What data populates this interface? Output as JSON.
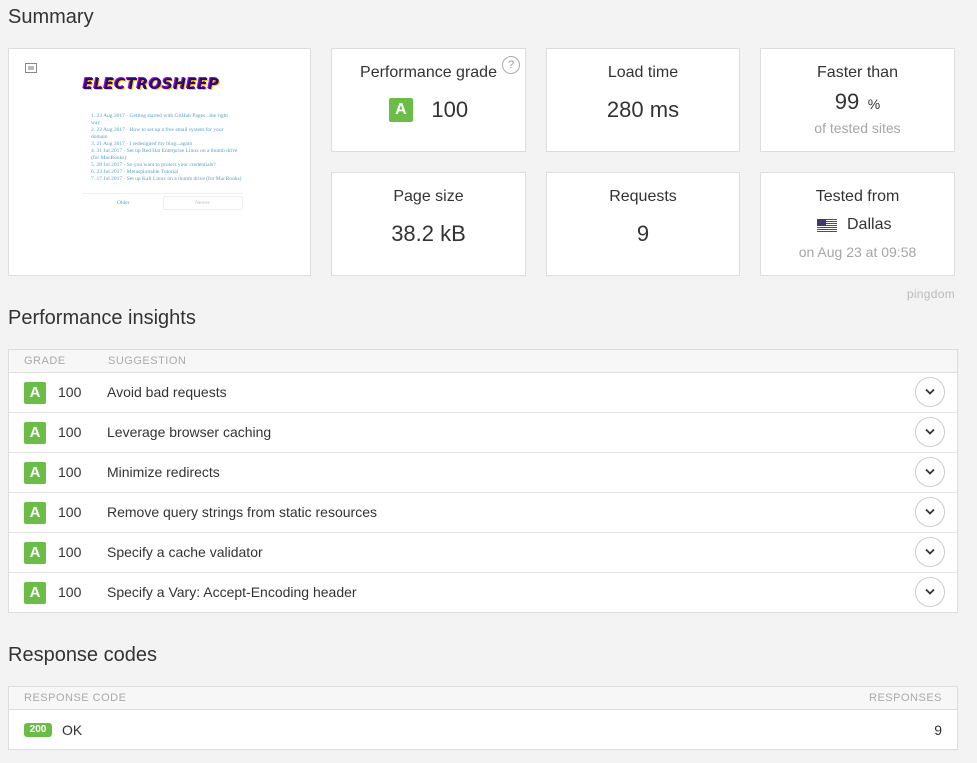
{
  "summary": {
    "title": "Summary",
    "thumbnail": {
      "logo": "ELECTROSHEEP",
      "lines": [
        "1. 23 Aug 2017 · Getting started with GitHub Pages...the right",
        "way",
        "2. 22 Aug 2017 · How to set up a free email system for your",
        "domain",
        "3. 21 Aug 2017 · I redesigned my blog...again",
        "4. 31 Jul 2017 · Set up Red Hat Enterprise Linux on a thumb drive",
        "(for MacBooks)",
        "5. 28 Jul 2017 · So you want to protect your credentials?",
        "6. 23 Jul 2017 · Metasploitable Tutorial",
        "7. 17 Jul 2017 · Set up Kali Linux on a thumb drive (for MacBooks)"
      ],
      "older": "Older",
      "newer": "Newer"
    },
    "performance": {
      "label": "Performance grade",
      "grade": "A",
      "score": "100",
      "help": "?"
    },
    "load_time": {
      "label": "Load time",
      "value": "280 ms"
    },
    "faster_than": {
      "label": "Faster than",
      "value": "99",
      "unit": "%",
      "sub": "of tested sites"
    },
    "page_size": {
      "label": "Page size",
      "value": "38.2 kB"
    },
    "requests": {
      "label": "Requests",
      "value": "9"
    },
    "tested_from": {
      "label": "Tested from",
      "location": "Dallas",
      "sub": "on Aug 23 at 09:58"
    },
    "brand": "pingdom"
  },
  "insights": {
    "title": "Performance insights",
    "headers": {
      "grade": "GRADE",
      "suggestion": "SUGGESTION"
    },
    "rows": [
      {
        "grade": "A",
        "score": "100",
        "suggestion": "Avoid bad requests"
      },
      {
        "grade": "A",
        "score": "100",
        "suggestion": "Leverage browser caching"
      },
      {
        "grade": "A",
        "score": "100",
        "suggestion": "Minimize redirects"
      },
      {
        "grade": "A",
        "score": "100",
        "suggestion": "Remove query strings from static resources"
      },
      {
        "grade": "A",
        "score": "100",
        "suggestion": "Specify a cache validator"
      },
      {
        "grade": "A",
        "score": "100",
        "suggestion": "Specify a Vary: Accept-Encoding header"
      }
    ]
  },
  "response_codes": {
    "title": "Response codes",
    "headers": {
      "code": "RESPONSE CODE",
      "responses": "RESPONSES"
    },
    "rows": [
      {
        "code": "200",
        "label": "OK",
        "count": "9"
      }
    ]
  },
  "colors": {
    "grade_a": "#6bbd47",
    "background": "#f3f3f3"
  }
}
